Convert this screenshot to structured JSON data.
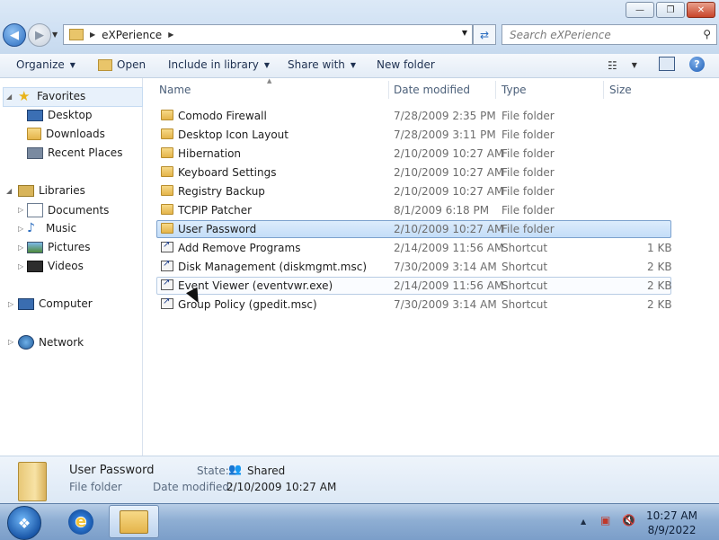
{
  "window": {
    "minimize": "—",
    "maximize": "❐",
    "close": "✕"
  },
  "address": {
    "crumb": "eXPerience"
  },
  "search": {
    "placeholder": "Search eXPerience"
  },
  "toolbar": {
    "organize": "Organize",
    "open": "Open",
    "include": "Include in library",
    "share": "Share with",
    "new_folder": "New folder"
  },
  "nav": {
    "favorites": "Favorites",
    "desktop": "Desktop",
    "downloads": "Downloads",
    "recent": "Recent Places",
    "libraries": "Libraries",
    "documents": "Documents",
    "music": "Music",
    "pictures": "Pictures",
    "videos": "Videos",
    "computer": "Computer",
    "network": "Network"
  },
  "columns": {
    "name": "Name",
    "date": "Date modified",
    "type": "Type",
    "size": "Size"
  },
  "files": [
    {
      "name": "Comodo Firewall",
      "date": "7/28/2009 2:35 PM",
      "type": "File folder",
      "size": ""
    },
    {
      "name": "Desktop Icon Layout",
      "date": "7/28/2009 3:11 PM",
      "type": "File folder",
      "size": ""
    },
    {
      "name": "Hibernation",
      "date": "2/10/2009 10:27 AM",
      "type": "File folder",
      "size": ""
    },
    {
      "name": "Keyboard Settings",
      "date": "2/10/2009 10:27 AM",
      "type": "File folder",
      "size": ""
    },
    {
      "name": "Registry Backup",
      "date": "2/10/2009 10:27 AM",
      "type": "File folder",
      "size": ""
    },
    {
      "name": "TCPIP Patcher",
      "date": "8/1/2009 6:18 PM",
      "type": "File folder",
      "size": ""
    },
    {
      "name": "User Password",
      "date": "2/10/2009 10:27 AM",
      "type": "File folder",
      "size": ""
    },
    {
      "name": "Add Remove Programs",
      "date": "2/14/2009 11:56 AM",
      "type": "Shortcut",
      "size": "1 KB"
    },
    {
      "name": "Disk Management (diskmgmt.msc)",
      "date": "7/30/2009 3:14 AM",
      "type": "Shortcut",
      "size": "2 KB"
    },
    {
      "name": "Event Viewer (eventvwr.exe)",
      "date": "2/14/2009 11:56 AM",
      "type": "Shortcut",
      "size": "2 KB"
    },
    {
      "name": "Group Policy (gpedit.msc)",
      "date": "7/30/2009 3:14 AM",
      "type": "Shortcut",
      "size": "2 KB"
    }
  ],
  "details": {
    "name": "User Password",
    "kind": "File folder",
    "state_label": "State:",
    "state_value": "Shared",
    "date_label": "Date modified:",
    "date_value": "2/10/2009 10:27 AM"
  },
  "clock": {
    "time": "10:27 AM",
    "date": "8/9/2022"
  }
}
